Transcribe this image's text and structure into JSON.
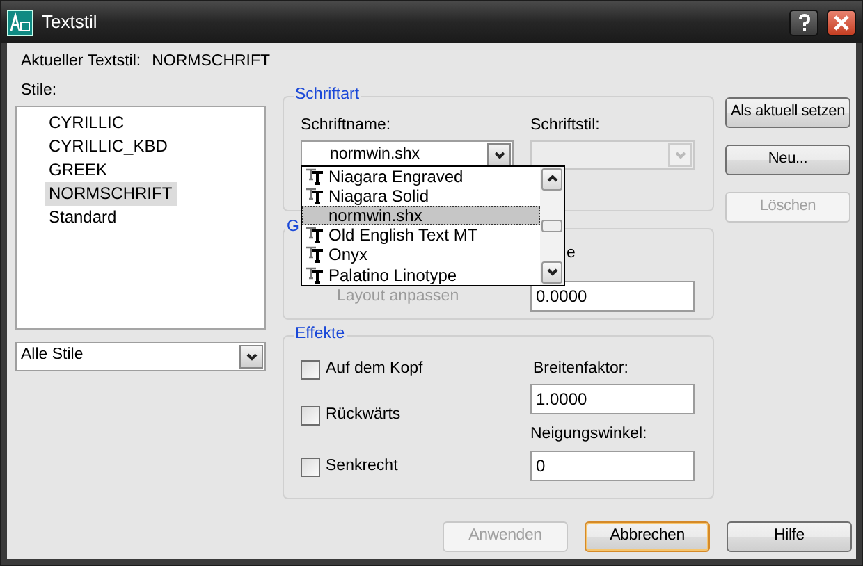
{
  "window": {
    "title": "Textstil"
  },
  "current_style": {
    "label": "Aktueller Textstil:",
    "value": "NORMSCHRIFT"
  },
  "styles": {
    "label": "Stile:",
    "items": [
      {
        "name": "CYRILLIC",
        "selected": false
      },
      {
        "name": "CYRILLIC_KBD",
        "selected": false
      },
      {
        "name": "GREEK",
        "selected": false
      },
      {
        "name": "NORMSCHRIFT",
        "selected": true
      },
      {
        "name": "Standard",
        "selected": false
      }
    ],
    "filter": {
      "value": "Alle Stile"
    }
  },
  "font_group": {
    "legend": "Schriftart",
    "font_name": {
      "label": "Schriftname:",
      "value": "normwin.shx",
      "expanded": true,
      "options": [
        {
          "kind": "truetype",
          "label": "Niagara Engraved",
          "selected": false
        },
        {
          "kind": "truetype",
          "label": "Niagara Solid",
          "selected": false
        },
        {
          "kind": "shx",
          "label": "normwin.shx",
          "selected": true
        },
        {
          "kind": "truetype",
          "label": "Old English Text MT",
          "selected": false
        },
        {
          "kind": "truetype",
          "label": "Onyx",
          "selected": false
        },
        {
          "kind": "truetype",
          "label": "Palatino Linotype",
          "selected": false
        }
      ]
    },
    "font_style": {
      "label": "Schriftstil:",
      "disabled": true
    }
  },
  "size_group": {
    "legend": "G",
    "height_label": "e",
    "layout_fit": {
      "label": "Layout anpassen",
      "disabled": true
    },
    "height": {
      "value": "0.0000"
    }
  },
  "effects_group": {
    "legend": "Effekte",
    "checkboxes": [
      {
        "label": "Auf dem Kopf",
        "checked": false
      },
      {
        "label": "Rückwärts",
        "checked": false
      },
      {
        "label": "Senkrecht",
        "checked": false
      }
    ],
    "width_factor": {
      "label": "Breitenfaktor:",
      "value": "1.0000"
    },
    "oblique_angle": {
      "label": "Neigungswinkel:",
      "value": "0"
    }
  },
  "side_buttons": [
    {
      "label": "Als aktuell setzen",
      "disabled": false
    },
    {
      "label": "Neu...",
      "disabled": false
    },
    {
      "label": "Löschen",
      "disabled": true
    }
  ],
  "footer_buttons": [
    {
      "label": "Anwenden",
      "disabled": true,
      "default": false
    },
    {
      "label": "Abbrechen",
      "disabled": false,
      "default": true
    },
    {
      "label": "Hilfe",
      "disabled": false,
      "default": false
    }
  ]
}
